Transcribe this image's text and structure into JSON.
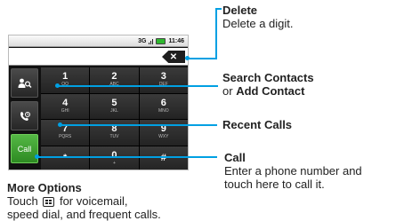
{
  "status": {
    "network": "3G",
    "time": "11:46"
  },
  "phone_number": "",
  "sidebar": {
    "call_label": "Call"
  },
  "keypad": [
    {
      "digit": "1",
      "letters": "QO"
    },
    {
      "digit": "2",
      "letters": "ABC"
    },
    {
      "digit": "3",
      "letters": "DEF"
    },
    {
      "digit": "4",
      "letters": "GHI"
    },
    {
      "digit": "5",
      "letters": "JKL"
    },
    {
      "digit": "6",
      "letters": "MNO"
    },
    {
      "digit": "7",
      "letters": "PQRS"
    },
    {
      "digit": "8",
      "letters": "TUV"
    },
    {
      "digit": "9",
      "letters": "WXY"
    },
    {
      "digit": "*",
      "letters": ""
    },
    {
      "digit": "0",
      "letters": "+"
    },
    {
      "digit": "#",
      "letters": ""
    }
  ],
  "callouts": {
    "delete_title": "Delete",
    "delete_desc": "Delete a digit.",
    "search_title": "Search Contacts",
    "search_or": "or",
    "search_add": "Add Contact",
    "recent_title": "Recent Calls",
    "call_title": "Call",
    "call_desc_1": "Enter a phone number and",
    "call_desc_2": "touch here to call it.",
    "more_title": "More Options",
    "more_touch": "Touch",
    "more_desc_1": "for voicemail,",
    "more_desc_2": "speed dial, and frequent calls."
  }
}
